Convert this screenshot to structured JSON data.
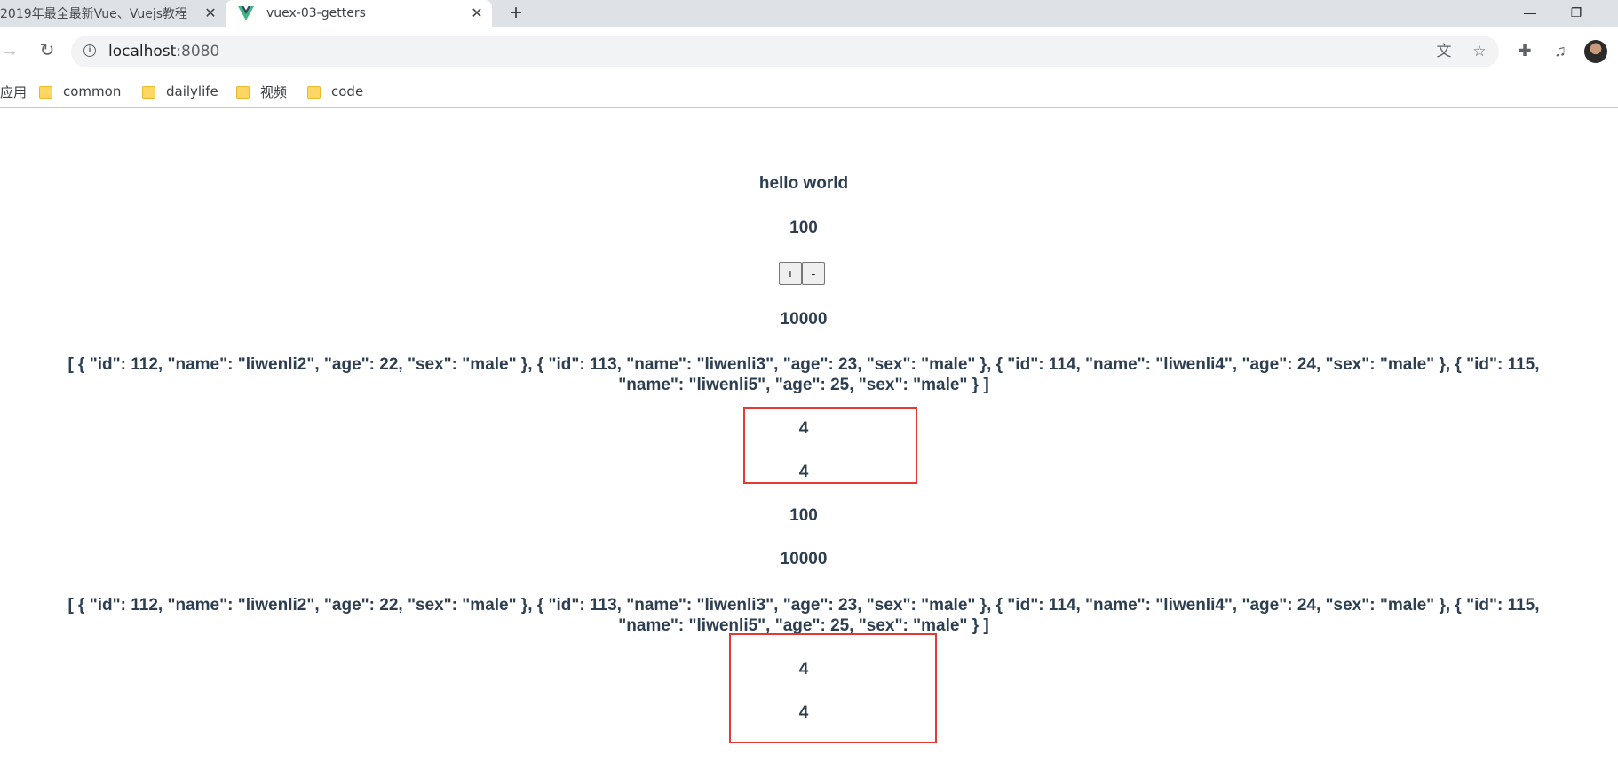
{
  "browser": {
    "tabs": [
      {
        "title": "2019年最全最新Vue、Vuejs教程"
      },
      {
        "title": "vuex-03-getters",
        "active": true
      }
    ],
    "new_tab_glyph": "+",
    "address": {
      "host": "localhost",
      "port": ":8080"
    },
    "bookmarks": [
      "应用",
      "common",
      "dailylife",
      "视频",
      "code"
    ]
  },
  "page": {
    "message": "hello world",
    "counter": "100",
    "buttons": {
      "increment": "+",
      "decrement": "-"
    },
    "power": "10000",
    "students_json_1": "[ { \"id\": 112, \"name\": \"liwenli2\", \"age\": 22, \"sex\": \"male\" }, { \"id\": 113, \"name\": \"liwenli3\", \"age\": 23, \"sex\": \"male\" }, { \"id\": 114, \"name\": \"liwenli4\", \"age\": 24, \"sex\": \"male\" }, { \"id\": 115,",
    "students_json_2": "\"name\": \"liwenli5\", \"age\": 25, \"sex\": \"male\" } ]",
    "length_a": "4",
    "length_b": "4",
    "child": {
      "counter": "100",
      "power": "10000",
      "students_json_1": "[ { \"id\": 112, \"name\": \"liwenli2\", \"age\": 22, \"sex\": \"male\" }, { \"id\": 113, \"name\": \"liwenli3\", \"age\": 23, \"sex\": \"male\" }, { \"id\": 114, \"name\": \"liwenli4\", \"age\": 24, \"sex\": \"male\" }, { \"id\": 115,",
      "students_json_2": "\"name\": \"liwenli5\", \"age\": 25, \"sex\": \"male\" } ]",
      "length_a": "4",
      "length_b": "4"
    }
  },
  "colors": {
    "text": "#2c3e50",
    "highlight_border": "#e53935"
  }
}
